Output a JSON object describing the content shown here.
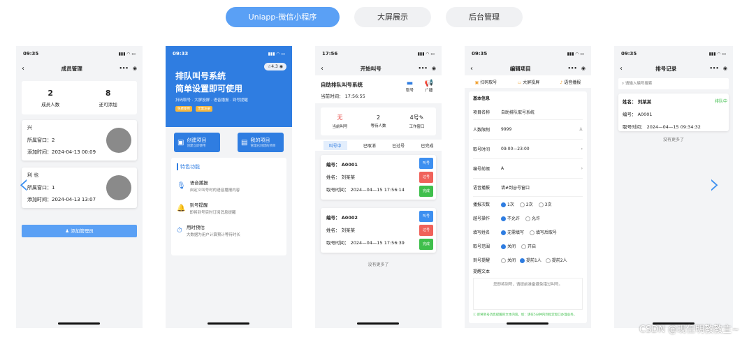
{
  "tabs": [
    "Uniapp-微信小程序",
    "大屏展示",
    "后台管理"
  ],
  "phone1": {
    "time": "09:35",
    "title": "成员管理",
    "stats": [
      {
        "value": "2",
        "label": "成员人数"
      },
      {
        "value": "8",
        "label": "还可添加"
      }
    ],
    "members": [
      {
        "name": "兴",
        "window": "所属窗口：2",
        "added": "添加时间：2024-04-13 00:09"
      },
      {
        "name": "利 也",
        "window": "所属窗口：1",
        "added": "添加时间：2024-04-13 13:07"
      }
    ],
    "add_button": "添加管理员"
  },
  "phone2": {
    "time": "09:33",
    "rating": "4.3",
    "hero_line1": "排队叫号系统",
    "hero_line2": "简单设置即可使用",
    "hero_sub": "扫码取号 · 大屏投屏 · 语音播报 · 到号提醒",
    "hero_tags": [
      "免费使用",
      "无需注册"
    ],
    "create": {
      "title": "创建项目",
      "sub": "创建立即使用"
    },
    "mine": {
      "title": "我的项目",
      "sub": "管理已创建的项目"
    },
    "features_title": "特色功能",
    "features": [
      {
        "title": "语音播报",
        "desc": "自定义叫号时的语音播报内容"
      },
      {
        "title": "到号提醒",
        "desc": "即将到号实时订阅消息提醒"
      },
      {
        "title": "用时预估",
        "desc": "大数据为用户计算预计等待时长"
      }
    ]
  },
  "phone3": {
    "time": "17:56",
    "title": "开始叫号",
    "project": "自助排队叫号系统",
    "current_time": "当前时间： 17:56:55",
    "actions": [
      "取号",
      "广播"
    ],
    "stats": [
      {
        "value": "无",
        "label": "当前叫号"
      },
      {
        "value": "2",
        "label": "等待人数"
      },
      {
        "value": "4号",
        "label": "工作窗口"
      }
    ],
    "filters": [
      "叫号中",
      "已取消",
      "已过号",
      "已完成"
    ],
    "tickets": [
      {
        "no": "编号： A0001",
        "name": "姓名： 刘某某",
        "time": "取号时间： 2024—04—15 17:56:14"
      },
      {
        "no": "编号： A0002",
        "name": "姓名： 刘某某",
        "time": "取号时间： 2024—04—15 17:56:39"
      }
    ],
    "ticket_buttons": [
      "叫号",
      "过号",
      "完成"
    ],
    "end": "没有更多了"
  },
  "phone4": {
    "time": "09:35",
    "title": "编辑项目",
    "toolbar": [
      "扫码取号",
      "大屏投屏",
      "语音播报"
    ],
    "section": "基本信息",
    "fields": [
      {
        "label": "项目名称",
        "value": "自助排队取号系统"
      },
      {
        "label": "人数限制",
        "value": "9999"
      },
      {
        "label": "取号时间",
        "value": "09:00—23:00"
      },
      {
        "label": "编号前缀",
        "value": "A"
      },
      {
        "label": "语音播报",
        "value": "请#到@号窗口"
      }
    ],
    "radios": [
      {
        "label": "播报次数",
        "options": [
          "1次",
          "2次",
          "3次"
        ]
      },
      {
        "label": "越号操作",
        "options": [
          "不允许",
          "允许"
        ]
      },
      {
        "label": "填写姓名",
        "options": [
          "无需填写",
          "填写后取号"
        ]
      },
      {
        "label": "取号范围",
        "options": [
          "关闭",
          "开启"
        ]
      },
      {
        "label": "到号提醒",
        "options": [
          "关闭",
          "提前1人",
          "提前2人"
        ]
      }
    ],
    "remind_label": "提醒文本",
    "remind_placeholder": "您即将到号，请提前准备避免错过叫号。",
    "footnote": "即将到号消息提醒的文本内容。如：请在5分钟内到指定窗口办理业务。"
  },
  "phone5": {
    "time": "09:35",
    "title": "排号记录",
    "search_placeholder": "请输入编号搜索",
    "record": {
      "name": "姓名： 刘某某",
      "status": "排队中",
      "no": "编号： A0001",
      "time": "取号时间： 2024—04—15 09:34:32"
    },
    "end": "没有更多了"
  },
  "watermark": "CSDN @现任明教教主~"
}
